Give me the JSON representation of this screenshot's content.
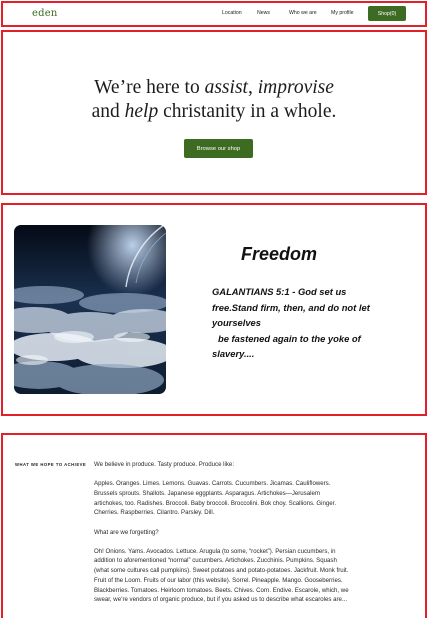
{
  "header": {
    "logo": "eden",
    "nav": [
      "Location",
      "News",
      "Who we are",
      "My profile"
    ],
    "shop_label": "Shop(0)",
    "accent": "#3e6b22"
  },
  "hero": {
    "line1_pre": "We’re here to ",
    "line1_em1": "assist",
    "line1_mid": ", ",
    "line1_em2": "improvise",
    "line2_pre": "and ",
    "line2_em": "help",
    "line2_post": " christanity in a whole.",
    "button_label": "Browse our shop"
  },
  "freedom": {
    "title": "Freedom",
    "verse_lines": [
      "GALANTIANS 5:1 - God set us",
      "free.Stand firm, then, and do not let",
      "yourselves",
      "be fastened again to the yoke of",
      "slavery...."
    ]
  },
  "achieve": {
    "label": "WHAT WE HOPE TO ACHIEVE",
    "paragraphs": [
      "We believe in produce. Tasty produce. Produce like:",
      "Apples. Oranges. Limes. Lemons. Guavas. Carrots. Cucumbers. Jicamas. Cauliflowers. Brussels sprouts. Shallots. Japanese eggplants. Asparagus. Artichokes—Jerusalem artichokes, too. Radishes. Broccoli. Baby broccoli. Broccolini. Bok choy. Scallions. Ginger. Cherries. Raspberries. Cilantro. Parsley. Dill.",
      "What are we forgetting?",
      "Oh! Onions. Yams. Avocados. Lettuce. Arugula (to some, “rocket”). Persian cucumbers, in addition to aforementioned “normal” cucumbers. Artichokes. Zucchinis. Pumpkins. Squash (what some cultures call pumpkins). Sweet potatoes and potato-potatoes. Jackfruit. Monk fruit. Fruit of the Loom. Fruits of our labor (this website). Sorrel. Pineapple. Mango. Gooseberries. Blackberries. Tomatoes. Heirloom tomatoes. Beets. Chives. Corn. Endive. Escarole, which, we swear, we’re vendors of organic produce, but if you asked us to describe what escaroles are..."
    ]
  },
  "colors": {
    "frame": "#e3202a",
    "brand_green": "#3e6b22"
  }
}
